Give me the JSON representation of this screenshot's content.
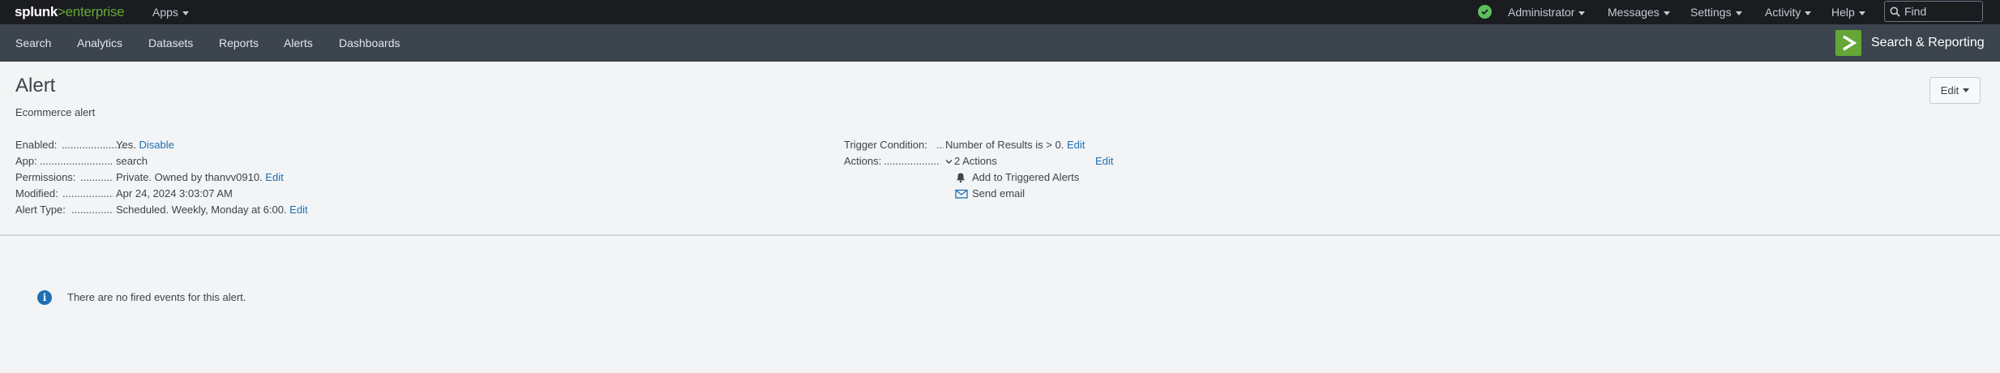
{
  "topbar": {
    "logo_main": "splunk",
    "logo_sep": ">",
    "logo_product": "enterprise",
    "apps_label": "Apps",
    "menus": [
      "Administrator",
      "Messages",
      "Settings",
      "Activity",
      "Help"
    ],
    "find_placeholder": "Find",
    "health_icon": "check-circle-icon",
    "health_color": "#5cc05c"
  },
  "appbar": {
    "nav": [
      "Search",
      "Analytics",
      "Datasets",
      "Reports",
      "Alerts",
      "Dashboards"
    ],
    "app_title": "Search & Reporting",
    "app_logo_color": "#65a637"
  },
  "page": {
    "title": "Alert",
    "description": "Ecommerce alert",
    "edit_button": "Edit"
  },
  "properties": {
    "enabled": {
      "label": "Enabled:",
      "value": "Yes.",
      "action": "Disable"
    },
    "app": {
      "label": "App:",
      "value": "search"
    },
    "permissions": {
      "label": "Permissions:",
      "value": "Private. Owned by thanvv0910.",
      "action": "Edit"
    },
    "modified": {
      "label": "Modified:",
      "value": "Apr 24, 2024 3:03:07 AM"
    },
    "alert_type": {
      "label": "Alert Type:",
      "value": "Scheduled. Weekly, Monday at 6:00.",
      "action": "Edit"
    }
  },
  "trigger": {
    "label": "Trigger Condition:",
    "value": "Number of Results is > 0.",
    "action": "Edit"
  },
  "actions": {
    "label": "Actions:",
    "count": "2 Actions",
    "edit": "Edit",
    "items": [
      {
        "label": "Add to Triggered Alerts",
        "icon": "bell-icon"
      },
      {
        "label": "Send email",
        "icon": "envelope-icon"
      }
    ]
  },
  "events": {
    "message": "There are no fired events for this alert.",
    "icon": "info-icon"
  },
  "colors": {
    "link": "#1e6fb5",
    "topbar_bg": "#1a1c20",
    "appbar_bg": "#3c444d",
    "page_bg": "#f2f4f5"
  }
}
